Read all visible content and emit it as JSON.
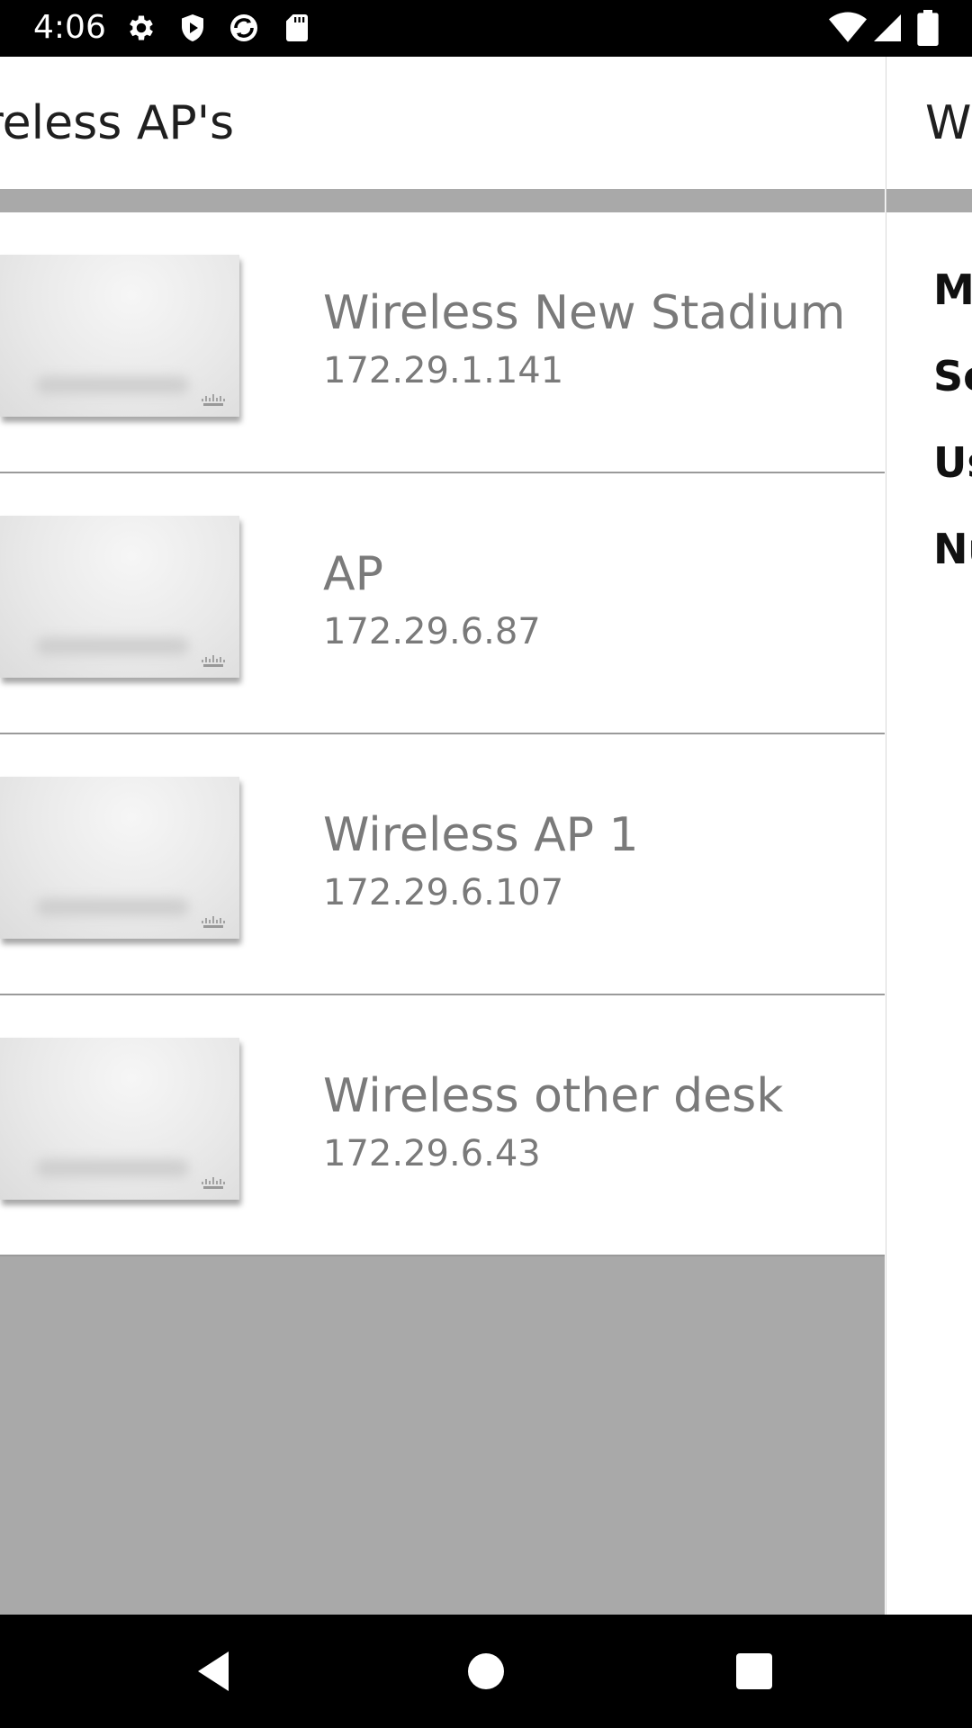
{
  "status_bar": {
    "time": "4:06",
    "left_icons": [
      "gear-icon",
      "shield-play-icon",
      "sync-icon",
      "sd-card-icon"
    ],
    "right_icons": [
      "wifi-icon",
      "signal-icon",
      "battery-icon"
    ]
  },
  "left_pane": {
    "title": "ireless AP's",
    "items": [
      {
        "name": "Wireless New Stadium",
        "ip": "172.29.1.141"
      },
      {
        "name": "AP",
        "ip": "172.29.6.87"
      },
      {
        "name": "Wireless AP 1",
        "ip": "172.29.6.107"
      },
      {
        "name": "Wireless other desk",
        "ip": "172.29.6.43"
      }
    ]
  },
  "right_pane": {
    "title": "Wi",
    "labels": [
      "M",
      "Se",
      "Us",
      "Nu"
    ]
  },
  "nav_bar": {
    "buttons": [
      "back-icon",
      "home-icon",
      "recents-icon"
    ]
  },
  "colors": {
    "status_bar": "#000000",
    "band_gray": "#a9a9a9",
    "text_gray": "#7a7a7a",
    "title_dark": "#1f1f1f"
  }
}
